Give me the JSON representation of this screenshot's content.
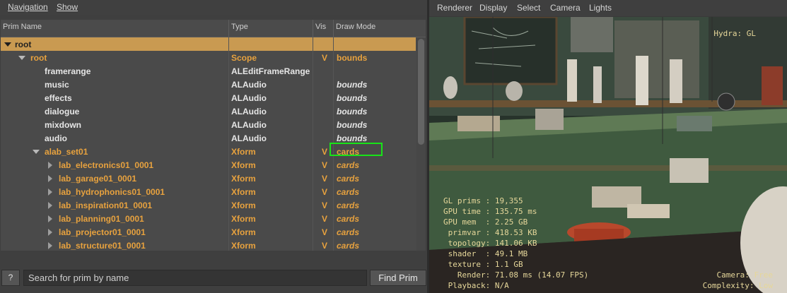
{
  "left_menu": {
    "items": [
      "Navigation",
      "Show"
    ]
  },
  "tree": {
    "headers": {
      "name": "Prim Name",
      "type": "Type",
      "vis": "Vis",
      "draw_mode": "Draw Mode"
    },
    "rows": [
      {
        "name": "root",
        "type": "",
        "vis": "",
        "draw_mode": "",
        "style": "sel",
        "arrow": "down",
        "indent": 0,
        "dm_italic": false
      },
      {
        "name": "root",
        "type": "Scope",
        "vis": "V",
        "draw_mode": "bounds",
        "style": "orange",
        "arrow": "down",
        "indent": 1,
        "dm_italic": false
      },
      {
        "name": "framerange",
        "type": "ALEditFrameRange",
        "vis": "",
        "draw_mode": "",
        "style": "white",
        "arrow": "none",
        "indent": 2,
        "dm_italic": false
      },
      {
        "name": "music",
        "type": "ALAudio",
        "vis": "",
        "draw_mode": "bounds",
        "style": "white",
        "arrow": "none",
        "indent": 2,
        "dm_italic": true
      },
      {
        "name": "effects",
        "type": "ALAudio",
        "vis": "",
        "draw_mode": "bounds",
        "style": "white",
        "arrow": "none",
        "indent": 2,
        "dm_italic": true
      },
      {
        "name": "dialogue",
        "type": "ALAudio",
        "vis": "",
        "draw_mode": "bounds",
        "style": "white",
        "arrow": "none",
        "indent": 2,
        "dm_italic": true
      },
      {
        "name": "mixdown",
        "type": "ALAudio",
        "vis": "",
        "draw_mode": "bounds",
        "style": "white",
        "arrow": "none",
        "indent": 2,
        "dm_italic": true
      },
      {
        "name": "audio",
        "type": "ALAudio",
        "vis": "",
        "draw_mode": "bounds",
        "style": "white",
        "arrow": "none",
        "indent": 2,
        "dm_italic": true
      },
      {
        "name": "alab_set01",
        "type": "Xform",
        "vis": "V",
        "draw_mode": "cards",
        "style": "orange",
        "arrow": "down",
        "indent": 2,
        "dm_italic": false
      },
      {
        "name": "lab_electronics01_0001",
        "type": "Xform",
        "vis": "V",
        "draw_mode": "cards",
        "style": "orange",
        "arrow": "right",
        "indent": 3,
        "dm_italic": true
      },
      {
        "name": "lab_garage01_0001",
        "type": "Xform",
        "vis": "V",
        "draw_mode": "cards",
        "style": "orange",
        "arrow": "right",
        "indent": 3,
        "dm_italic": true
      },
      {
        "name": "lab_hydrophonics01_0001",
        "type": "Xform",
        "vis": "V",
        "draw_mode": "cards",
        "style": "orange",
        "arrow": "right",
        "indent": 3,
        "dm_italic": true
      },
      {
        "name": "lab_inspiration01_0001",
        "type": "Xform",
        "vis": "V",
        "draw_mode": "cards",
        "style": "orange",
        "arrow": "right",
        "indent": 3,
        "dm_italic": true
      },
      {
        "name": "lab_planning01_0001",
        "type": "Xform",
        "vis": "V",
        "draw_mode": "cards",
        "style": "orange",
        "arrow": "right",
        "indent": 3,
        "dm_italic": true
      },
      {
        "name": "lab_projector01_0001",
        "type": "Xform",
        "vis": "V",
        "draw_mode": "cards",
        "style": "orange",
        "arrow": "right",
        "indent": 3,
        "dm_italic": true
      },
      {
        "name": "lab_structure01_0001",
        "type": "Xform",
        "vis": "V",
        "draw_mode": "cards",
        "style": "orange",
        "arrow": "right",
        "indent": 3,
        "dm_italic": true
      }
    ]
  },
  "search": {
    "help_label": "?",
    "placeholder": "Search for prim by name",
    "find_label": "Find Prim"
  },
  "viewer_menu": {
    "items": [
      "Renderer",
      "Display",
      "Select",
      "Camera",
      "Lights"
    ]
  },
  "hud": {
    "hydra": "Hydra: GL",
    "stats": "GL prims : 19,355\nGPU time : 135.75 ms\nGPU mem  : 2.25 GB\n primvar : 418.53 KB\n topology: 141.06 KB\n shader  : 49.1 MB\n texture : 1.1 GB\n   Render: 71.08 ms (14.07 FPS)\n Playback: N/A",
    "camera": "Camera: Free\nComplexity: Low"
  },
  "colors": {
    "accent_selected": "#c99a51",
    "prim_orange": "#e8a23e",
    "highlight_green": "#18e418",
    "hud_text": "#e6d79a"
  }
}
